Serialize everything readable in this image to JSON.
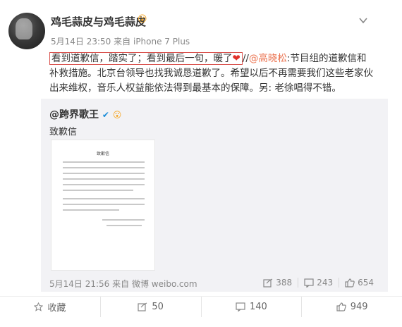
{
  "post": {
    "username": "鸡毛蒜皮与鸡毛蒜皮",
    "badge_icon": "emoji-badge-icon",
    "date": "5月14日 23:50",
    "source_prefix": "来自",
    "source": "iPhone 7 Plus",
    "text_highlighted": "看到道歉信，踏实了；看到最后一句，暖了",
    "heart": "❤",
    "text_separator": "//",
    "mention": "@高晓松",
    "text_rest": ":节目组的道歉信和补救措施。北京台领导也找我诚恳道歉了。希望以后不再需要我们这些老家伙出来维权，音乐人权益能依法得到最基本的保障。另: 老徐唱得不错。"
  },
  "repost": {
    "username": "@跨界歌王",
    "verified_icon": "v-verified-icon",
    "text": "致歉信",
    "letter_title": "致歉信",
    "date": "5月14日 21:56",
    "source_prefix": "来自",
    "source": "微博 weibo.com",
    "forward_count": "388",
    "comment_count": "243",
    "like_count": "654"
  },
  "actions": {
    "favorite": "收藏",
    "forward": "50",
    "comment": "140",
    "like": "949"
  },
  "colors": {
    "mention": "#eb7350",
    "highlight_border": "#d9534f",
    "heart": "#e0322b",
    "verified": "#1a8cd8"
  }
}
